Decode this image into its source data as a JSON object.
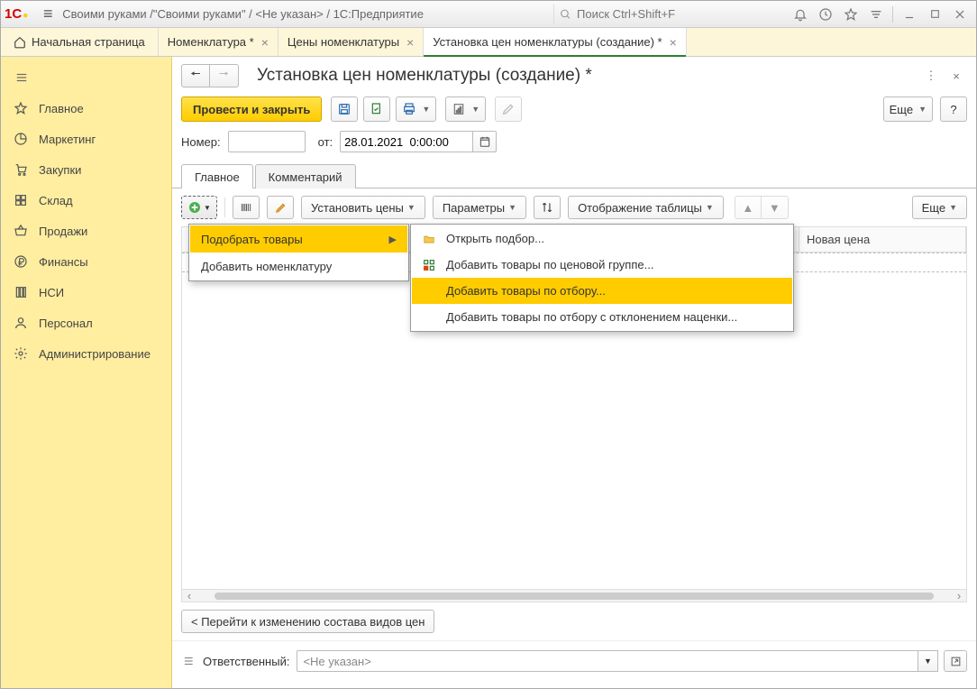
{
  "titlebar": {
    "title": "Своими руками /\"Своими руками\" / <Не указан> / 1С:Предприятие",
    "search_placeholder": "Поиск Ctrl+Shift+F"
  },
  "tabs": {
    "home": "Начальная страница",
    "items": [
      {
        "label": "Номенклатура *"
      },
      {
        "label": "Цены номенклатуры"
      },
      {
        "label": "Установка цен номенклатуры (создание) *"
      }
    ]
  },
  "sidebar": {
    "items": [
      {
        "label": "Главное"
      },
      {
        "label": "Маркетинг"
      },
      {
        "label": "Закупки"
      },
      {
        "label": "Склад"
      },
      {
        "label": "Продажи"
      },
      {
        "label": "Финансы"
      },
      {
        "label": "НСИ"
      },
      {
        "label": "Персонал"
      },
      {
        "label": "Администрирование"
      }
    ]
  },
  "doc": {
    "title": "Установка цен номенклатуры (создание) *",
    "post_and_close": "Провести и закрыть",
    "more": "Еще",
    "help": "?",
    "number_label": "Номер:",
    "from_label": "от:",
    "date_value": "28.01.2021  0:00:00"
  },
  "inner_tabs": {
    "main": "Главное",
    "comment": "Комментарий"
  },
  "grid_toolbar": {
    "set_prices": "Установить цены",
    "params": "Параметры",
    "table_view": "Отображение таблицы",
    "more": "Еще"
  },
  "menu1": {
    "pick_goods": "Подобрать товары",
    "add_nomenclature": "Добавить номенклатуру"
  },
  "menu2": {
    "open_selection": "Открыть подбор...",
    "by_price_group": "Добавить товары по ценовой группе...",
    "by_filter": "Добавить товары по отбору...",
    "by_filter_margin": "Добавить товары по отбору с отклонением наценки..."
  },
  "grid": {
    "col_new_price": "Новая цена"
  },
  "below_grid": {
    "goto_price_types": "< Перейти к изменению состава видов цен"
  },
  "footer": {
    "responsible_label": "Ответственный:",
    "responsible_value": "<Не указан>"
  }
}
